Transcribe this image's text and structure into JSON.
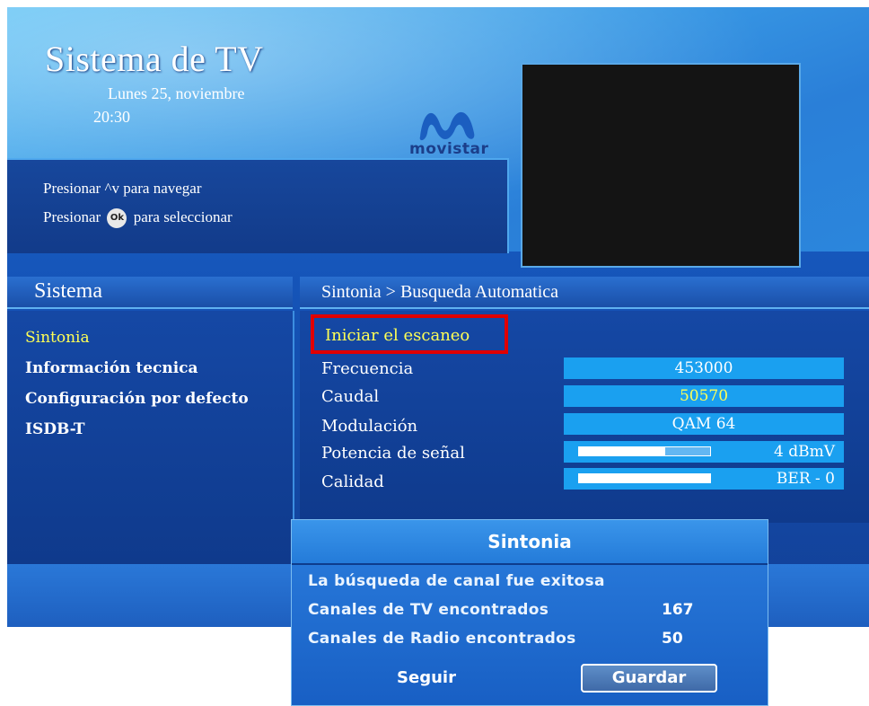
{
  "header": {
    "title": "Sistema de TV",
    "date": "Lunes 25, noviembre",
    "time": "20:30",
    "brand": "movistar",
    "nav_hint_prefix": "Presionar",
    "nav_hint_arrows": "^v",
    "nav_hint_suffix": "para navegar",
    "select_hint_prefix": "Presionar",
    "select_hint_key": "Ok",
    "select_hint_suffix": "para seleccionar"
  },
  "sidebar": {
    "title": "Sistema",
    "items": [
      {
        "label": "Sintonia",
        "active": true
      },
      {
        "label": "Información tecnica",
        "active": false
      },
      {
        "label": "Configuración por defecto",
        "active": false
      },
      {
        "label": "ISDB-T",
        "active": false
      }
    ]
  },
  "main": {
    "breadcrumb": "Sintonia > Busqueda Automatica",
    "scan_button": "Iniciar el escaneo",
    "fields": {
      "frecuencia_label": "Frecuencia",
      "frecuencia_value": "453000",
      "caudal_label": "Caudal",
      "caudal_value": "50570",
      "modulacion_label": "Modulación",
      "modulacion_value": "QAM 64",
      "potencia_label": "Potencia de señal",
      "potencia_value": "4 dBmV",
      "potencia_level": 0.65,
      "calidad_label": "Calidad",
      "calidad_value": "BER - 0",
      "calidad_level": 1.0
    }
  },
  "dialog": {
    "title": "Sintonia",
    "message": "La búsqueda de canal fue exitosa",
    "tv_label": "Canales de TV encontrados",
    "tv_count": "167",
    "radio_label": "Canales de Radio encontrados",
    "radio_count": "50",
    "continue_button": "Seguir",
    "save_button": "Guardar"
  },
  "colors": {
    "highlight": "#ffff55",
    "focus_border": "#e00000",
    "value_box": "#1aa0f0",
    "logo_blue": "#1b5ec0"
  }
}
